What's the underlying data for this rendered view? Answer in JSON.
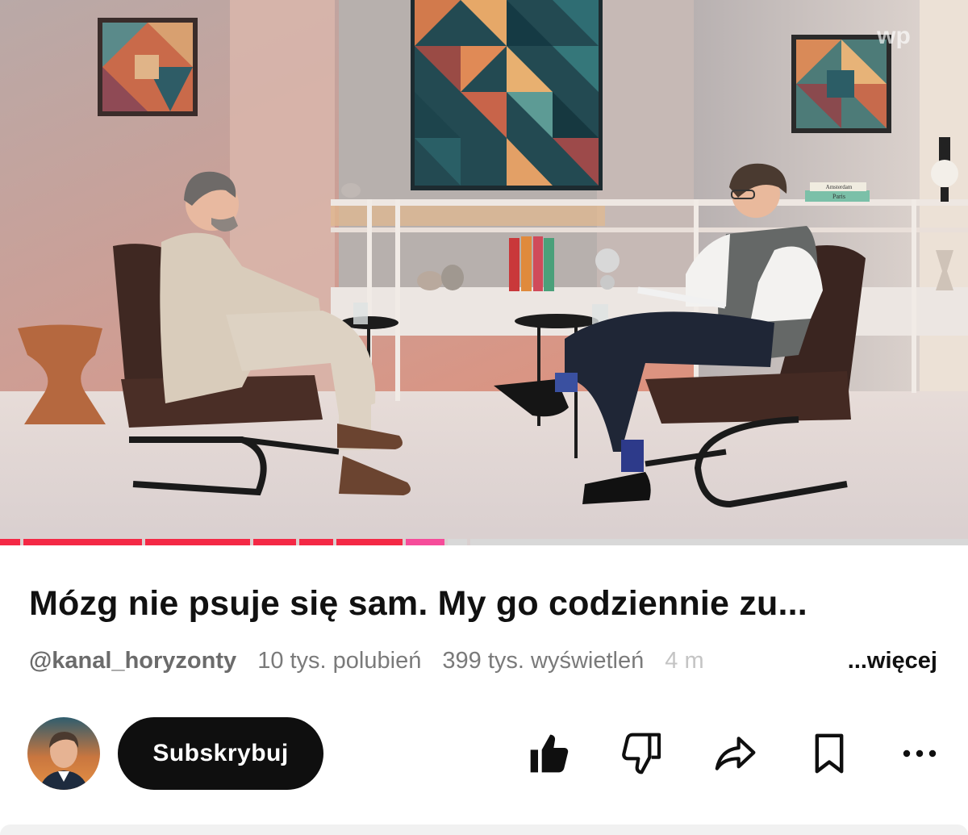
{
  "video": {
    "watermark": "wp",
    "book_labels": [
      "Amsterdam",
      "Paris"
    ],
    "progress": {
      "played_fraction": 0.49
    }
  },
  "title": "Mózg nie psuje się sam. My go codziennie zu...",
  "meta": {
    "channel_handle": "@kanal_horyzonty",
    "likes": "10 tys. polubień",
    "views": "399 tys. wyświetleń",
    "age_fragment": "4 m",
    "more_label": "...więcej"
  },
  "actions": {
    "subscribe_label": "Subskrybuj",
    "icons": [
      "like-icon",
      "dislike-icon",
      "share-icon",
      "save-icon",
      "more-icon"
    ]
  },
  "colors": {
    "progress_played": "#f42845",
    "subscribe_bg": "#0f0f0f",
    "title_text": "#111111",
    "meta_text": "#7a7a7a"
  }
}
